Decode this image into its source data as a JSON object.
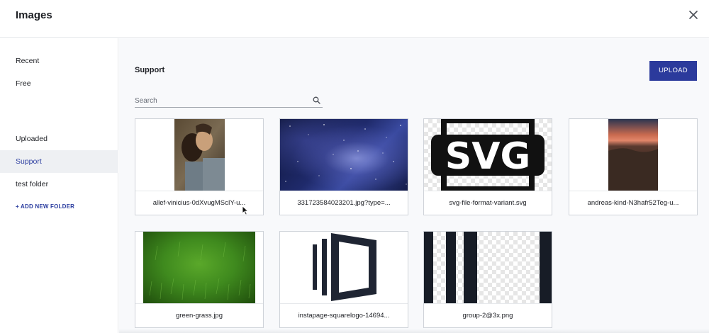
{
  "dialog": {
    "title": "Images",
    "close_icon": "close-icon"
  },
  "sidebar": {
    "items": [
      {
        "label": "Recent"
      },
      {
        "label": "Free"
      },
      {
        "label": "Uploaded"
      },
      {
        "label": "Support",
        "active": true
      },
      {
        "label": "test folder"
      }
    ],
    "add_folder_label": "+ ADD NEW FOLDER"
  },
  "main": {
    "section_title": "Support",
    "upload_label": "UPLOAD",
    "search_placeholder": "Search",
    "search_icon": "search-icon",
    "images": [
      {
        "name": "allef-vinicius-0dXvugMScIY-u..."
      },
      {
        "name": "331723584023201.jpg?type=..."
      },
      {
        "name": "svg-file-format-variant.svg"
      },
      {
        "name": "andreas-kind-N3hafr52Teg-u..."
      },
      {
        "name": "green-grass.jpg"
      },
      {
        "name": "instapage-squarelogo-14694..."
      },
      {
        "name": "group-2@3x.png"
      }
    ]
  },
  "colors": {
    "accent": "#2b3a9c",
    "active_bg": "#eef0f3",
    "text": "#1d1f24"
  }
}
